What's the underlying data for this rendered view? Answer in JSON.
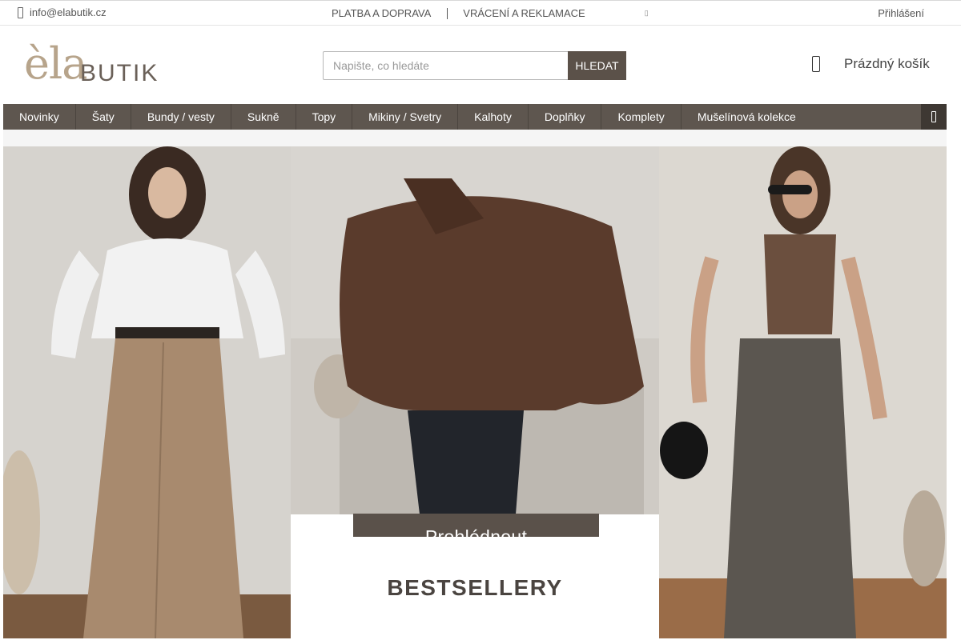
{
  "topbar": {
    "email": "info@elabutik.cz",
    "links": [
      "PLATBA A DOPRAVA",
      "VRÁCENÍ A REKLAMACE"
    ],
    "login": "Přihlášení"
  },
  "header": {
    "logo_ela": "èla",
    "logo_butik": "BUTIK",
    "search_placeholder": "Napište, co hledáte",
    "search_button": "HLEDAT",
    "cart_label": "Prázdný košík"
  },
  "nav": {
    "items": [
      "Novinky",
      "Šaty",
      "Bundy / vesty",
      "Sukně",
      "Topy",
      "Mikiny / Svetry",
      "Kalhoty",
      "Doplňky",
      "Komplety",
      "Mušelínová kolekce"
    ]
  },
  "hero": {
    "cta": "Prohlédnout",
    "caption": "BESTSELLERY"
  },
  "colors": {
    "nav_bg": "#5e564f",
    "accent_dark": "#5b5149",
    "logo_tan": "#b7a48b"
  },
  "icons": {
    "mail": "mail-icon",
    "cart": "cart-icon",
    "menu": "menu-icon"
  }
}
